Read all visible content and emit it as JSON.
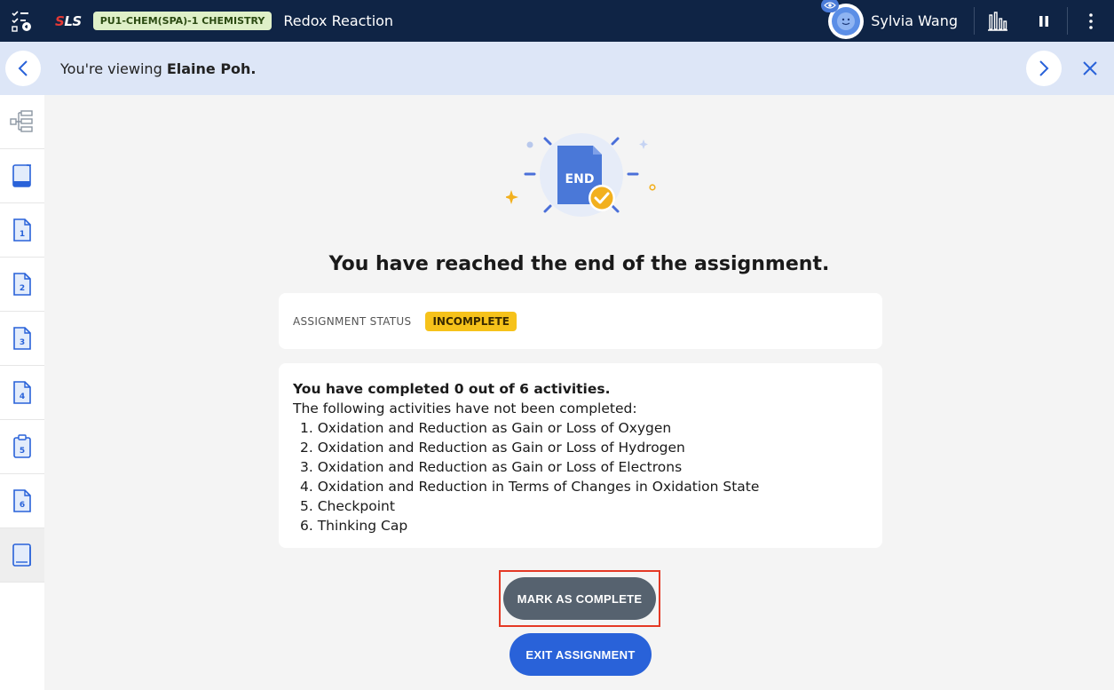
{
  "topbar": {
    "logo_prefix": "S",
    "logo_rest": "LS",
    "course_badge": "PU1-CHEM(SPA)-1 CHEMISTRY",
    "title": "Redox Reaction",
    "user_name": "Sylvia Wang"
  },
  "viewbar": {
    "prefix": "You're viewing ",
    "student": "Elaine Poh."
  },
  "sidebar": {
    "items": [
      {
        "icon": "tree-structure-icon",
        "label": ""
      },
      {
        "icon": "book-cover-icon",
        "label": ""
      },
      {
        "icon": "page-icon",
        "label": "1"
      },
      {
        "icon": "page-icon",
        "label": "2"
      },
      {
        "icon": "page-icon",
        "label": "3"
      },
      {
        "icon": "page-icon",
        "label": "4"
      },
      {
        "icon": "clipboard-icon",
        "label": "5"
      },
      {
        "icon": "page-icon",
        "label": "6"
      },
      {
        "icon": "book-end-icon",
        "label": ""
      }
    ]
  },
  "main": {
    "end_label": "END",
    "heading": "You have reached the end of the assignment.",
    "status_label": "ASSIGNMENT STATUS",
    "status_value": "INCOMPLETE",
    "summary": "You have completed 0 out of 6 activities.",
    "subtext": "The following activities have not been completed:",
    "activities": [
      "1. Oxidation and Reduction as Gain or Loss of Oxygen",
      "2. Oxidation and Reduction as Gain or Loss of Hydrogen",
      "3. Oxidation and Reduction as Gain or Loss of Electrons",
      "4. Oxidation and Reduction in Terms of Changes in Oxidation State",
      "5. Checkpoint",
      "6. Thinking Cap"
    ],
    "mark_complete_label": "MARK AS COMPLETE",
    "exit_label": "EXIT ASSIGNMENT"
  },
  "colors": {
    "topbar": "#0f2445",
    "viewbar": "#dde6f7",
    "status_badge": "#f6c21a",
    "primary": "#2962d9",
    "mark_complete": "#56626f",
    "highlight": "#e53925"
  }
}
